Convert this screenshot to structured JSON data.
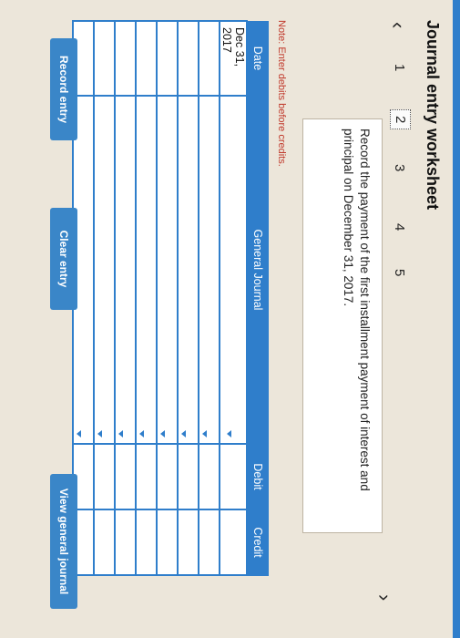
{
  "header": {
    "title": "Journal entry worksheet"
  },
  "nav": {
    "prev_icon": "chevron-left-icon",
    "next_icon": "chevron-right-icon",
    "steps": [
      "1",
      "2",
      "3",
      "4",
      "5"
    ],
    "active_step": "2"
  },
  "instruction": "Record the payment of the first installment payment of interest and principal on December 31, 2017.",
  "note": "Note: Enter debits before credits.",
  "table": {
    "headers": {
      "date": "Date",
      "journal": "General Journal",
      "debit": "Debit",
      "credit": "Credit"
    },
    "rows": [
      {
        "date": "Dec 31, 2017",
        "account": "",
        "debit": "",
        "credit": ""
      },
      {
        "date": "",
        "account": "",
        "debit": "",
        "credit": ""
      },
      {
        "date": "",
        "account": "",
        "debit": "",
        "credit": ""
      },
      {
        "date": "",
        "account": "",
        "debit": "",
        "credit": ""
      },
      {
        "date": "",
        "account": "",
        "debit": "",
        "credit": ""
      },
      {
        "date": "",
        "account": "",
        "debit": "",
        "credit": ""
      },
      {
        "date": "",
        "account": "",
        "debit": "",
        "credit": ""
      },
      {
        "date": "",
        "account": "",
        "debit": "",
        "credit": ""
      }
    ]
  },
  "buttons": {
    "record": "Record entry",
    "clear": "Clear entry",
    "view": "View general journal"
  },
  "colors": {
    "accent": "#2f7ecb",
    "note": "#c0392b"
  }
}
